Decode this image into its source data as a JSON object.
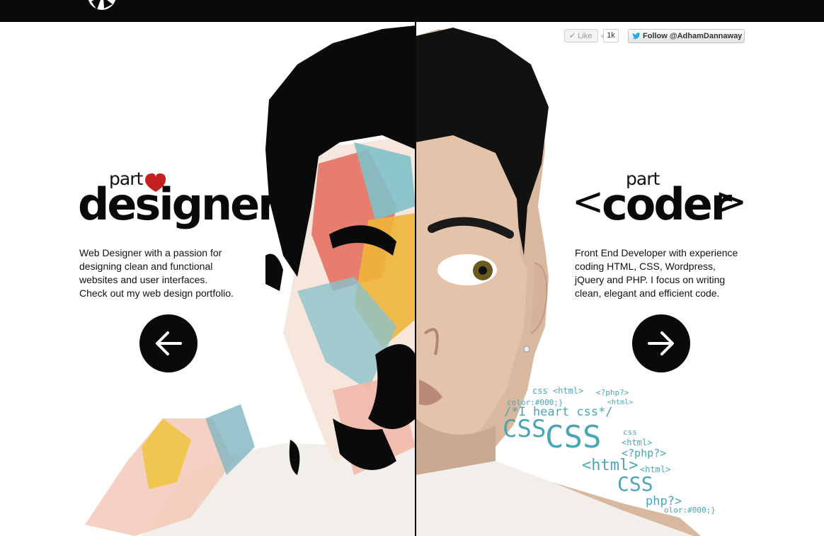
{
  "social": {
    "like_label": "Like",
    "like_count": "1k",
    "follow_label": "Follow @AdhamDannaway"
  },
  "left": {
    "part": "part",
    "title": "designer",
    "description_lines": [
      "Web Designer with a passion for",
      "designing clean and functional",
      "websites and user interfaces.",
      "Check out my web design portfolio."
    ]
  },
  "right": {
    "part": "part",
    "title": "coder",
    "bracket_open": "<",
    "bracket_close": ">",
    "description_lines": [
      "Front End Developer with experience",
      "coding HTML, CSS, Wordpress,",
      "jQuery and PHP. I focus on writing",
      "clean, elegant and efficient code."
    ]
  },
  "code_words": [
    "css <html>",
    "<?php?>",
    "color:#000;}",
    "<html>",
    "/*I heart css*/",
    "CSS",
    "css",
    "CSS",
    "<html>",
    "<?php?>",
    "<html>",
    "<html>",
    "CSS",
    "php?>",
    "olor:#000;}"
  ],
  "colors": {
    "topbar": "#0a0a0a",
    "heart": "#c41e1e",
    "code": "#4aa6b5"
  },
  "icons": {
    "left_arrow": "arrow-left-icon",
    "right_arrow": "arrow-right-icon",
    "heart": "heart-icon",
    "bird": "twitter-bird-icon"
  }
}
